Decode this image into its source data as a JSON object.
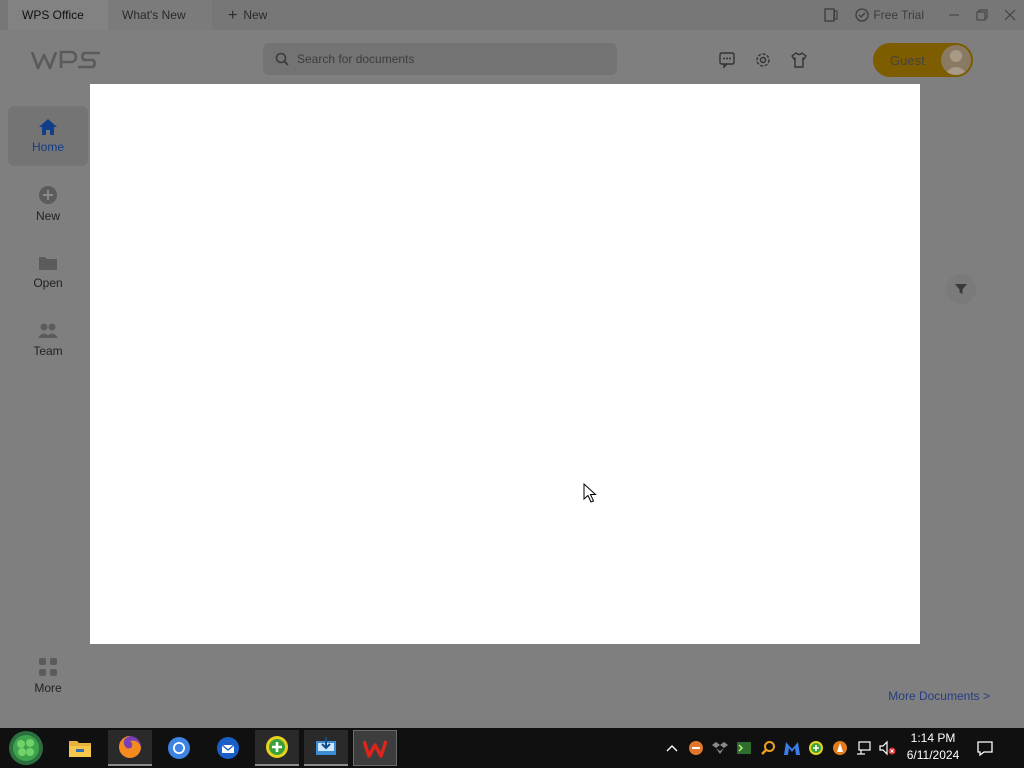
{
  "window": {
    "tabs": [
      {
        "label": "WPS Office"
      },
      {
        "label": "What's New"
      },
      {
        "label": "New"
      }
    ],
    "free_trial_label": "Free Trial"
  },
  "header": {
    "logo_text": "WPS",
    "search_placeholder": "Search for documents",
    "guest_label": "Guest"
  },
  "sidebar": {
    "items": [
      {
        "label": "Home",
        "icon": "home-icon"
      },
      {
        "label": "New",
        "icon": "plus-circle-icon"
      },
      {
        "label": "Open",
        "icon": "folder-icon"
      },
      {
        "label": "Team",
        "icon": "team-icon"
      }
    ],
    "more_label": "More"
  },
  "main": {
    "more_documents_label": "More Documents >"
  },
  "taskbar": {
    "time": "1:14 PM",
    "date": "6/11/2024"
  },
  "colors": {
    "accent": "#123d88",
    "guest_button": "#7d5d00",
    "wps_red": "#e0241b"
  }
}
